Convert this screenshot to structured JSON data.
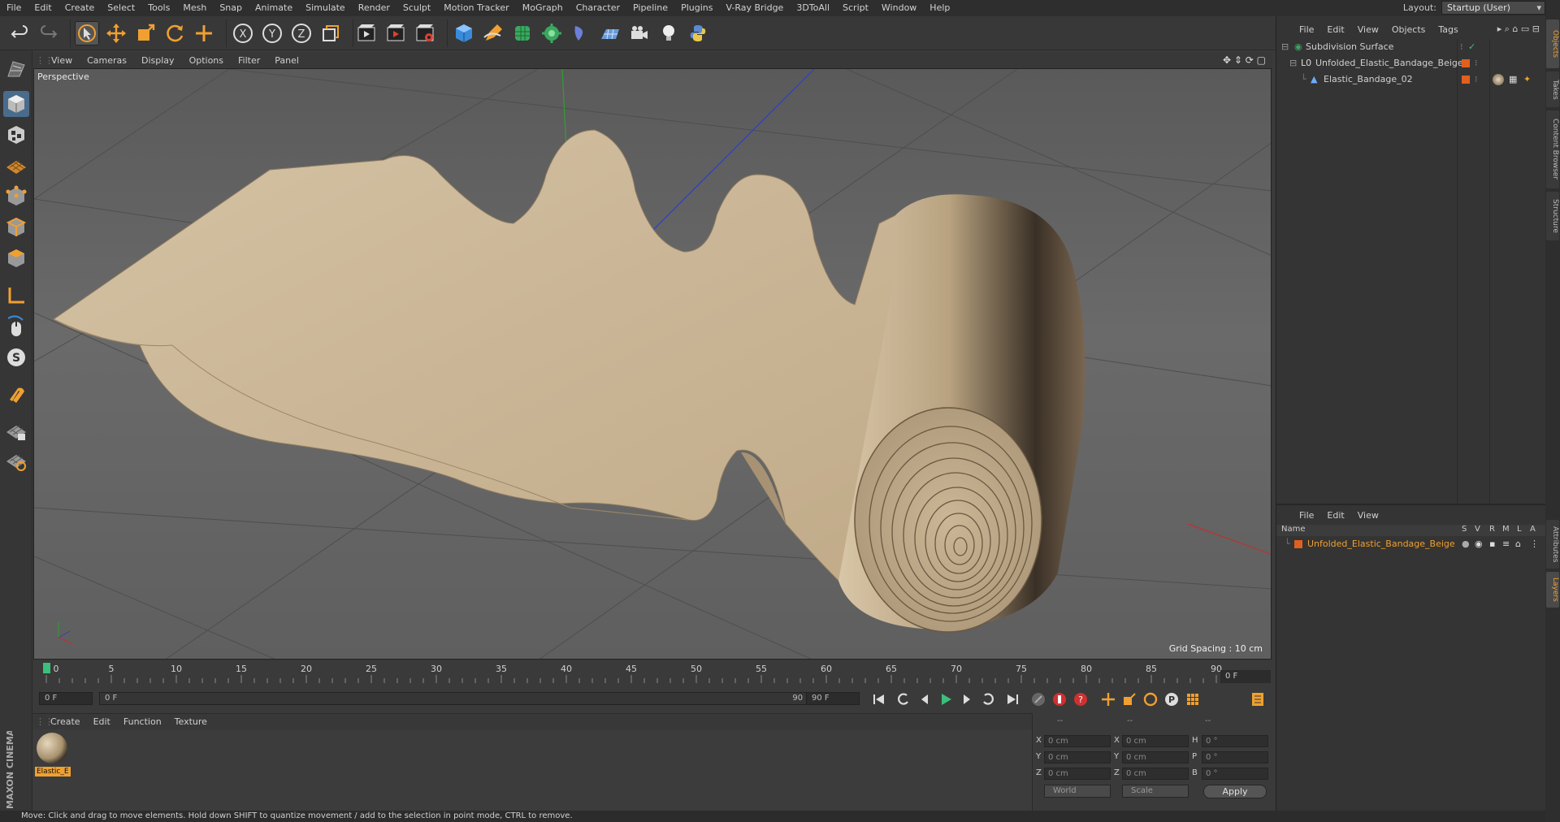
{
  "menubar": {
    "items": [
      "File",
      "Edit",
      "Create",
      "Select",
      "Tools",
      "Mesh",
      "Snap",
      "Animate",
      "Simulate",
      "Render",
      "Sculpt",
      "Motion Tracker",
      "MoGraph",
      "Character",
      "Pipeline",
      "Plugins",
      "V-Ray Bridge",
      "3DToAll",
      "Script",
      "Window",
      "Help"
    ],
    "layout_label": "Layout:",
    "layout_value": "Startup (User)"
  },
  "toolbar": {
    "icons": [
      "undo-icon",
      "redo-icon",
      "live-selection-icon",
      "move-icon",
      "scale-icon",
      "rotate-icon",
      "last-tool-icon",
      "x-axis-icon",
      "y-axis-icon",
      "z-axis-icon",
      "coordinate-system-icon",
      "render-view-icon",
      "render-picture-viewer-icon",
      "edit-render-settings-icon",
      "cube-icon",
      "pen-icon",
      "subdivision-icon",
      "cloner-icon",
      "deformer-icon",
      "floor-icon",
      "camera-icon",
      "light-icon",
      "python-icon"
    ],
    "axis_labels": [
      "X",
      "Y",
      "Z"
    ]
  },
  "viewport": {
    "menu": [
      "View",
      "Cameras",
      "Display",
      "Options",
      "Filter",
      "Panel"
    ],
    "label": "Perspective",
    "grid_spacing": "Grid Spacing : 10 cm"
  },
  "timeline": {
    "ticks": [
      "0",
      "5",
      "10",
      "15",
      "20",
      "25",
      "30",
      "35",
      "40",
      "45",
      "50",
      "55",
      "60",
      "65",
      "70",
      "75",
      "80",
      "85",
      "90"
    ],
    "current_frame": "0 F",
    "start_field": "0 F",
    "range_start": "0 F",
    "range_end": "90 F",
    "end_field": "90 F"
  },
  "material_panel": {
    "menu": [
      "Create",
      "Edit",
      "Function",
      "Texture"
    ],
    "material_name": "Elastic_E"
  },
  "coordinates": {
    "headers": [
      "--",
      "--",
      "--"
    ],
    "pos_labels": [
      "X",
      "Y",
      "Z"
    ],
    "pos_values": [
      "0 cm",
      "0 cm",
      "0 cm"
    ],
    "size_labels": [
      "X",
      "Y",
      "Z"
    ],
    "size_values": [
      "0 cm",
      "0 cm",
      "0 cm"
    ],
    "rot_labels": [
      "H",
      "P",
      "B"
    ],
    "rot_values": [
      "0 °",
      "0 °",
      "0 °"
    ],
    "mode_world": "World",
    "mode_scale": "Scale",
    "apply": "Apply"
  },
  "object_manager": {
    "menu": [
      "File",
      "Edit",
      "View",
      "Objects",
      "Tags"
    ],
    "objects": [
      {
        "name": "Subdivision Surface",
        "indent": 0
      },
      {
        "name": "Unfolded_Elastic_Bandage_Beige",
        "indent": 1
      },
      {
        "name": "Elastic_Bandage_02",
        "indent": 2
      }
    ]
  },
  "layer_manager": {
    "menu": [
      "File",
      "Edit",
      "View"
    ],
    "columns": [
      "Name",
      "S",
      "V",
      "R",
      "M",
      "L",
      "A"
    ],
    "layer_name": "Unfolded_Elastic_Bandage_Beige",
    "layer_color": "#e06020"
  },
  "side_tabs": [
    "Objects",
    "Takes",
    "Content Browser",
    "Structure",
    "Attributes",
    "Layers"
  ],
  "status": "Move: Click and drag to move elements. Hold down SHIFT to quantize movement / add to the selection in point mode, CTRL to remove.",
  "branding": "MAXON CINEMA 4D",
  "colors": {
    "accent_orange": "#f0a030",
    "bandage": "#cdb898",
    "axis_x": "#c03030",
    "axis_y": "#30a030",
    "axis_z": "#3040c0"
  }
}
